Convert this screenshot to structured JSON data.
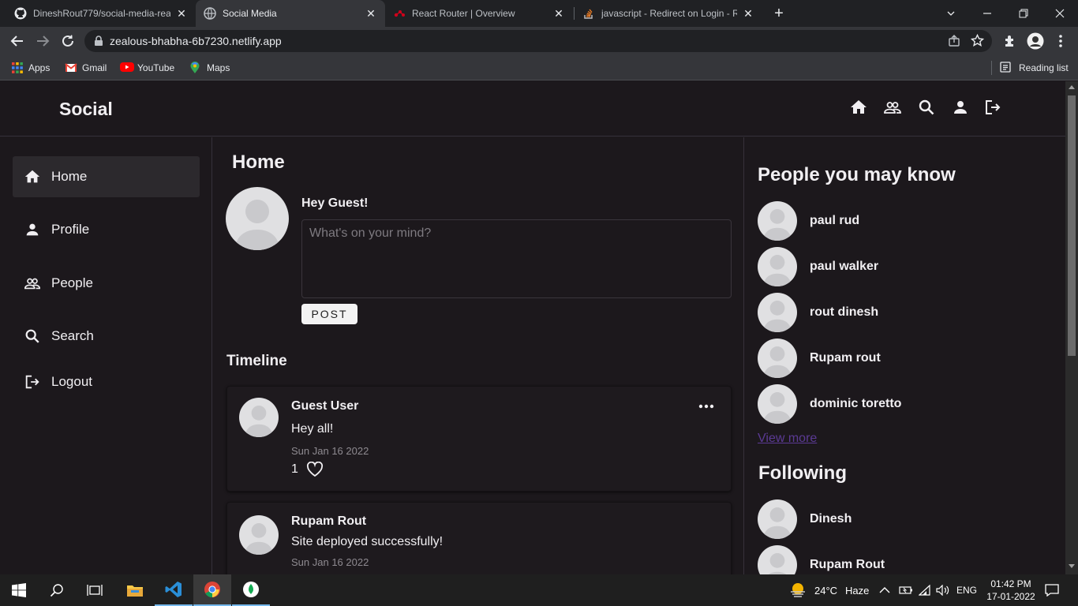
{
  "browser": {
    "tabs": [
      {
        "title": "DineshRout779/social-media-rea",
        "active": false
      },
      {
        "title": "Social Media",
        "active": true
      },
      {
        "title": "React Router | Overview",
        "active": false
      },
      {
        "title": "javascript - Redirect on Login - R",
        "active": false
      }
    ],
    "new_tab": "+",
    "url": "zealous-bhabha-6b7230.netlify.app",
    "bookmarks": [
      "Apps",
      "Gmail",
      "YouTube",
      "Maps"
    ],
    "reading_list": "Reading list"
  },
  "app": {
    "brand": "Social",
    "header_icons": [
      "home-icon",
      "people-icon",
      "search-icon",
      "person-icon",
      "logout-icon"
    ],
    "nav": [
      {
        "label": "Home",
        "icon": "home-icon",
        "active": true
      },
      {
        "label": "Profile",
        "icon": "person-icon",
        "active": false
      },
      {
        "label": "People",
        "icon": "people-icon",
        "active": false
      },
      {
        "label": "Search",
        "icon": "search-icon",
        "active": false
      },
      {
        "label": "Logout",
        "icon": "logout-icon",
        "active": false
      }
    ],
    "main": {
      "title": "Home",
      "greeting": "Hey Guest!",
      "composer_placeholder": "What's on your mind?",
      "post_button": "POST",
      "timeline_title": "Timeline",
      "posts": [
        {
          "author": "Guest User",
          "text": "Hey all!",
          "date": "Sun Jan 16 2022",
          "likes": "1"
        },
        {
          "author": "Rupam Rout",
          "text": "Site deployed successfully!",
          "date": "Sun Jan 16 2022"
        }
      ]
    },
    "suggestions": {
      "title": "People you may know",
      "people": [
        "paul rud",
        "paul walker",
        "rout dinesh",
        "Rupam rout",
        "dominic toretto"
      ],
      "view_more": "View more"
    },
    "following": {
      "title": "Following",
      "people": [
        "Dinesh",
        "Rupam Rout"
      ]
    }
  },
  "taskbar": {
    "weather_temp": "24°C",
    "weather_desc": "Haze",
    "language": "ENG",
    "time": "01:42 PM",
    "date": "17-01-2022"
  },
  "colors": {
    "app_bg": "#1c181c",
    "link": "#5b3a94",
    "chrome_dark": "#202124",
    "chrome_toolbar": "#35363a"
  }
}
